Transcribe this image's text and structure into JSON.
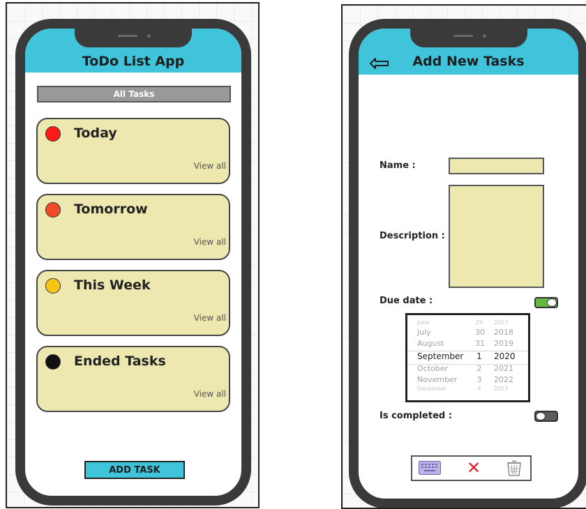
{
  "left_screen": {
    "title": "ToDo List App",
    "all_tasks_label": "All Tasks",
    "cards": [
      {
        "title": "Today",
        "link": "View all",
        "color": "#ff1a1a"
      },
      {
        "title": "Tomorrow",
        "link": "View all",
        "color": "#f04a2a"
      },
      {
        "title": "This Week",
        "link": "View all",
        "color": "#f5c518"
      },
      {
        "title": "Ended Tasks",
        "link": "View all",
        "color": "#111111"
      }
    ],
    "add_task_label": "ADD TASK"
  },
  "right_screen": {
    "title": "Add New Tasks",
    "back_icon": "back-arrow-icon",
    "name_label": "Name :",
    "description_label": "Description :",
    "due_date_label": "Due date :",
    "due_date_enabled": true,
    "is_completed_label": "Is completed :",
    "is_completed": false,
    "date_picker": {
      "rows": [
        {
          "month": "June",
          "day": "29",
          "year": "2017"
        },
        {
          "month": "July",
          "day": "30",
          "year": "2018"
        },
        {
          "month": "August",
          "day": "31",
          "year": "2019"
        },
        {
          "month": "September",
          "day": "1",
          "year": "2020"
        },
        {
          "month": "October",
          "day": "2",
          "year": "2021"
        },
        {
          "month": "November",
          "day": "3",
          "year": "2022"
        },
        {
          "month": "December",
          "day": "4",
          "year": "2023"
        }
      ]
    },
    "actions": {
      "keyboard_icon": "keyboard-icon",
      "close_symbol": "✕",
      "trash_icon": "trash-icon"
    }
  },
  "colors": {
    "header": "#3fc4db",
    "card_fill": "#ede8b0",
    "phone_body": "#3a3a3a",
    "toggle_on": "#67b843",
    "close": "#e02020"
  }
}
